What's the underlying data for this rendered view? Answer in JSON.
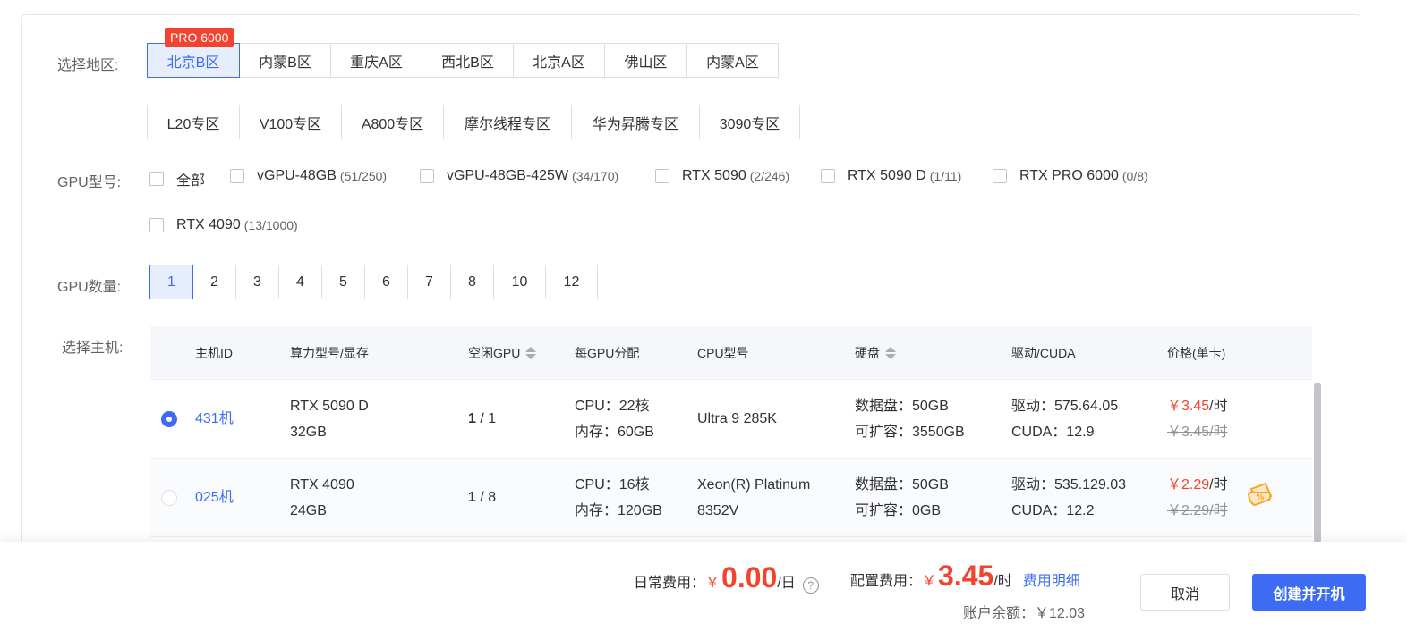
{
  "region": {
    "label": "选择地区:",
    "tag": "PRO 6000",
    "row1": [
      "北京B区",
      "内蒙B区",
      "重庆A区",
      "西北B区",
      "北京A区",
      "佛山区",
      "内蒙A区"
    ],
    "row2": [
      "L20专区",
      "V100专区",
      "A800专区",
      "摩尔线程专区",
      "华为昇腾专区",
      "3090专区"
    ],
    "selected": "北京B区"
  },
  "gpu_model": {
    "label": "GPU型号:",
    "options": [
      {
        "name": "全部",
        "count": ""
      },
      {
        "name": "vGPU-48GB",
        "count": "(51/250)"
      },
      {
        "name": "vGPU-48GB-425W",
        "count": "(34/170)"
      },
      {
        "name": "RTX 5090",
        "count": "(2/246)"
      },
      {
        "name": "RTX 5090 D",
        "count": "(1/11)"
      },
      {
        "name": "RTX PRO 6000",
        "count": "(0/8)"
      },
      {
        "name": "RTX 4090",
        "count": "(13/1000)"
      }
    ]
  },
  "gpu_count": {
    "label": "GPU数量:",
    "options": [
      "1",
      "2",
      "3",
      "4",
      "5",
      "6",
      "7",
      "8",
      "10",
      "12"
    ],
    "selected": "1"
  },
  "host": {
    "label": "选择主机:",
    "headers": [
      "主机ID",
      "算力型号/显存",
      "空闲GPU",
      "每GPU分配",
      "CPU型号",
      "硬盘",
      "驱动/CUDA",
      "价格(单卡)"
    ],
    "rows": [
      {
        "selected": true,
        "id": "431机",
        "model": "RTX 5090 D",
        "vram": "32GB",
        "free": "1",
        "total": " / 1",
        "cpu": "CPU：22核",
        "mem": "内存：60GB",
        "cpu_model_1": "Ultra 9 285K",
        "cpu_model_2": "",
        "disk": "数据盘：50GB",
        "expand": "可扩容：3550GB",
        "driver": "驱动：575.64.05",
        "cuda": "CUDA：12.9",
        "price": "￥3.45",
        "unit": "/时",
        "old_price": "￥3.45/时",
        "discount": false
      },
      {
        "selected": false,
        "id": "025机",
        "model": "RTX 4090",
        "vram": "24GB",
        "free": "1",
        "total": " / 8",
        "cpu": "CPU：16核",
        "mem": "内存：120GB",
        "cpu_model_1": "Xeon(R) Platinum",
        "cpu_model_2": "8352V",
        "disk": "数据盘：50GB",
        "expand": "可扩容：0GB",
        "driver": "驱动：535.129.03",
        "cuda": "CUDA：12.2",
        "price": "￥2.29",
        "unit": "/时",
        "old_price": "￥2.29/时",
        "discount": true
      }
    ]
  },
  "footer": {
    "daily_label": "日常费用：",
    "daily_yen": "￥",
    "daily_value": "0.00",
    "daily_unit": "/日",
    "help": "?",
    "config_label": "配置费用：",
    "config_yen": "￥",
    "config_value": "3.45",
    "config_unit": "/时",
    "detail_link": "费用明细",
    "balance": "账户余额：￥12.03",
    "cancel": "取消",
    "create": "创建并开机"
  },
  "colors": {
    "accent": "#3d6cf2",
    "price_red": "#f2432f",
    "discount_orange": "#f5a623"
  }
}
